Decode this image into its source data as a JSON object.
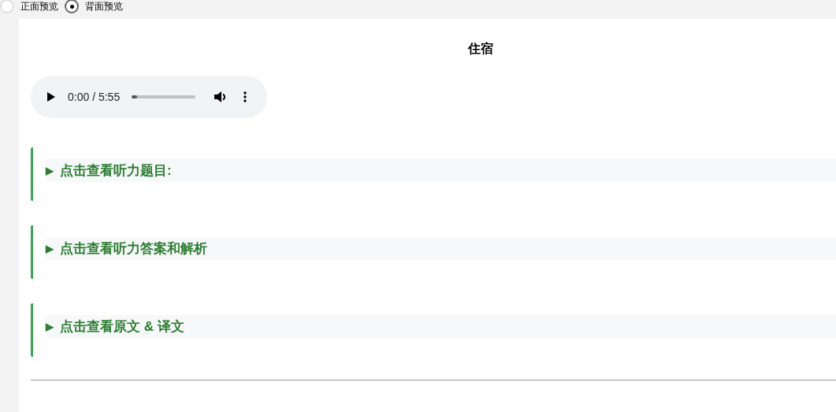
{
  "preview_options": [
    {
      "label": "正面预览",
      "selected": false
    },
    {
      "label": "背面预览",
      "selected": true
    }
  ],
  "title": "住宿",
  "audio_player": {
    "time": "0:00 / 5:55",
    "level": 0.08
  },
  "sections": [
    {
      "marker": "▶",
      "label": "点击查看听力题目:",
      "expanded": false
    },
    {
      "marker": "▶",
      "label": "点击查看听力答案和解析",
      "expanded": false
    },
    {
      "marker": "▶",
      "label": "点击查看原文 & 译文",
      "expanded": false
    }
  ]
}
